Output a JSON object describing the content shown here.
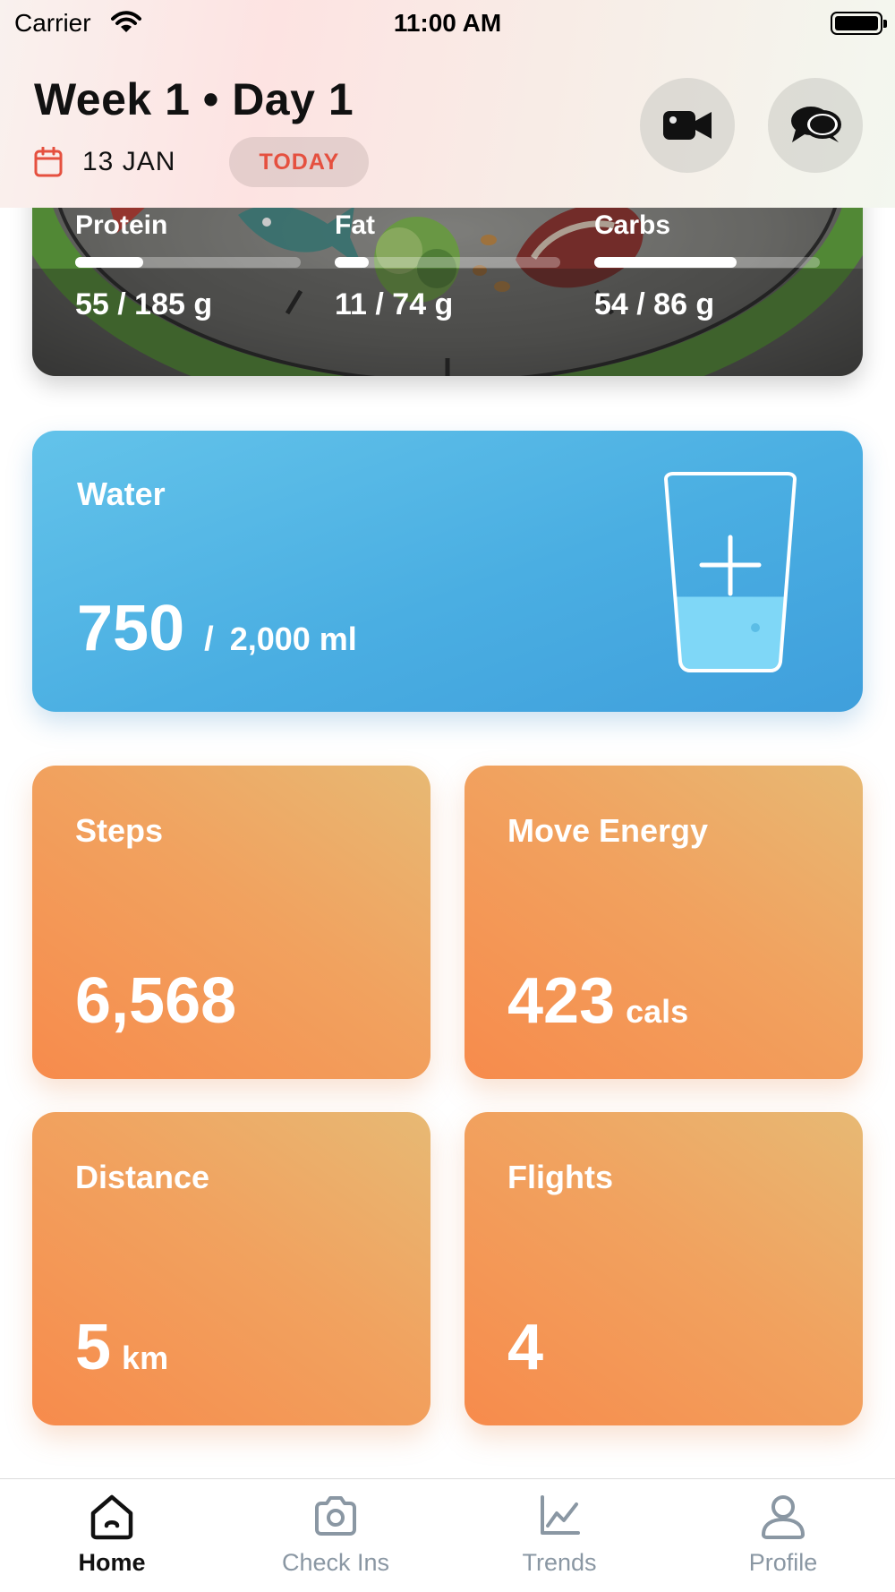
{
  "status_bar": {
    "carrier": "Carrier",
    "time": "11:00 AM"
  },
  "header": {
    "title": "Week 1 • Day 1",
    "date": "13 JAN",
    "today_label": "TODAY",
    "video_button_icon": "video-camera-icon",
    "chat_button_icon": "chat-bubbles-icon"
  },
  "macros": [
    {
      "label": "Protein",
      "value": "55 / 185 g",
      "progress": 0.3
    },
    {
      "label": "Fat",
      "value": "11 / 74 g",
      "progress": 0.15
    },
    {
      "label": "Carbs",
      "value": "54 / 86 g",
      "progress": 0.63
    }
  ],
  "water": {
    "title": "Water",
    "value": "750",
    "separator": "/",
    "goal": "2,000 ml",
    "progress": 0.375,
    "add_icon": "plus-icon"
  },
  "stats": [
    {
      "label": "Steps",
      "value": "6,568",
      "unit": ""
    },
    {
      "label": "Move Energy",
      "value": "423",
      "unit": "cals"
    },
    {
      "label": "Distance",
      "value": "5",
      "unit": "km"
    },
    {
      "label": "Flights",
      "value": "4",
      "unit": ""
    }
  ],
  "tabs": [
    {
      "label": "Home",
      "icon": "home-icon",
      "active": true
    },
    {
      "label": "Check Ins",
      "icon": "camera-icon",
      "active": false
    },
    {
      "label": "Trends",
      "icon": "chart-icon",
      "active": false
    },
    {
      "label": "Profile",
      "icon": "user-icon",
      "active": false
    }
  ],
  "colors": {
    "accent_red": "#e5503f",
    "water_blue": "#4aaee2",
    "tile_orange": "#f49455",
    "tab_inactive": "#8a97a3"
  }
}
